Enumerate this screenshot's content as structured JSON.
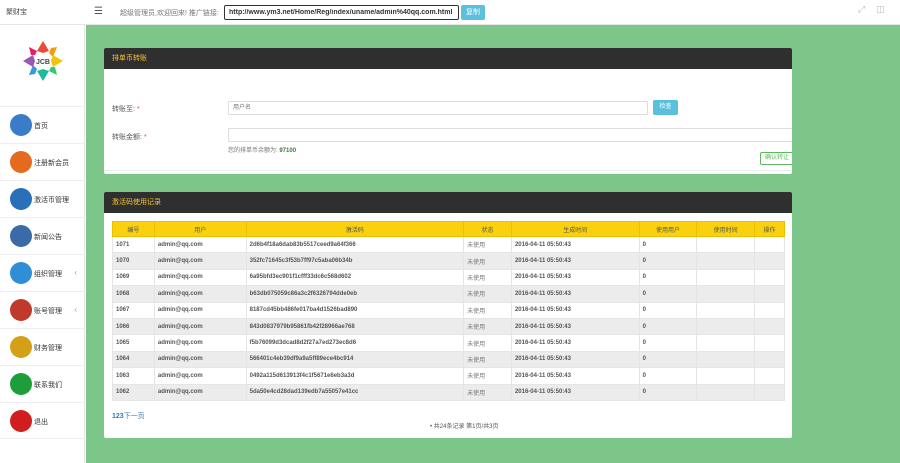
{
  "brand": "聚财宝",
  "topbar": {
    "welcome": "超级管理员,欢迎回来!  推广链接:",
    "promo_link": "http://www.ym3.net/Home/Reg/index/uname/admin%40qq.com.html",
    "copy_label": "复制"
  },
  "sidebar": {
    "items": [
      {
        "label": "首页",
        "icon": "home-icon",
        "color": "#3a7cc7",
        "caret": false
      },
      {
        "label": "注册新会员",
        "icon": "lock-icon",
        "color": "#e36a1e",
        "caret": false
      },
      {
        "label": "激活币管理",
        "icon": "globe-icon",
        "color": "#2a70b8",
        "caret": false
      },
      {
        "label": "新闻公告",
        "icon": "satellite-icon",
        "color": "#3b6aa8",
        "caret": false
      },
      {
        "label": "组织管理",
        "icon": "network-icon",
        "color": "#2f8ed6",
        "caret": true
      },
      {
        "label": "账号管理",
        "icon": "users-icon",
        "color": "#c0392b",
        "caret": true
      },
      {
        "label": "财务管理",
        "icon": "dollar-icon",
        "color": "#d4a017",
        "caret": false
      },
      {
        "label": "联系我们",
        "icon": "phone-icon",
        "color": "#1e9e3a",
        "caret": false
      },
      {
        "label": "退出",
        "icon": "power-icon",
        "color": "#d01e1e",
        "caret": false
      }
    ]
  },
  "transfer": {
    "title": "排单币转账",
    "to_label": "转账至:",
    "to_placeholder": "用户名",
    "check_label": "检查",
    "amount_label": "转账金额:",
    "balance_text": "您的排单币余额为:",
    "balance_value": "97100",
    "confirm_label": "确认转让"
  },
  "records": {
    "title": "激活码使用记录",
    "columns": [
      "编号",
      "用户",
      "激活码",
      "状态",
      "生成时间",
      "使用用户",
      "使用时间",
      "操作"
    ],
    "rows": [
      [
        "1071",
        "admin@qq.com",
        "2d6b4f18a6dab83b5517ceed9a64f366",
        "未使用",
        "2016-04-11 05:50:43",
        "0",
        "",
        ""
      ],
      [
        "1070",
        "admin@qq.com",
        "352fc71645c3f53b7ff97c5aba06b34b",
        "未使用",
        "2016-04-11 05:50:43",
        "0",
        "",
        ""
      ],
      [
        "1069",
        "admin@qq.com",
        "6a95bfd3ec901f1cfff33dc6c568d602",
        "未使用",
        "2016-04-11 05:50:43",
        "0",
        "",
        ""
      ],
      [
        "1068",
        "admin@qq.com",
        "b63db075059c86a3c2f6326794dde0eb",
        "未使用",
        "2016-04-11 05:50:43",
        "0",
        "",
        ""
      ],
      [
        "1067",
        "admin@qq.com",
        "8187cd45bb486fe017ba4d1526bad890",
        "未使用",
        "2016-04-11 05:50:43",
        "0",
        "",
        ""
      ],
      [
        "1066",
        "admin@qq.com",
        "843d0837979b95861fb42f28966ae768",
        "未使用",
        "2016-04-11 05:50:43",
        "0",
        "",
        ""
      ],
      [
        "1065",
        "admin@qq.com",
        "f5b76099d3dcad8d2f27a7ed273ec8d6",
        "未使用",
        "2016-04-11 05:50:43",
        "0",
        "",
        ""
      ],
      [
        "1064",
        "admin@qq.com",
        "566401c4eb39df9a9a5ff89ece4bc914",
        "未使用",
        "2016-04-11 05:50:43",
        "0",
        "",
        ""
      ],
      [
        "1063",
        "admin@qq.com",
        "0492a115d613913f4c1f5671e6eb3a3d",
        "未使用",
        "2016-04-11 05:50:43",
        "0",
        "",
        ""
      ],
      [
        "1062",
        "admin@qq.com",
        "5da50e4cd28dad139edb7a55057e41cc",
        "未使用",
        "2016-04-11 05:50:43",
        "0",
        "",
        ""
      ]
    ],
    "pager_links": "123",
    "pager_next": "下一页",
    "pager_info": "共24条记录 第1页/共3页"
  },
  "colors": {
    "main_bg": "#7cc68a",
    "panel_head_bg": "#2f2f2f",
    "panel_head_text": "#f5c33b",
    "table_head_bg": "#f9d10f",
    "accent_button": "#5bc0de"
  }
}
